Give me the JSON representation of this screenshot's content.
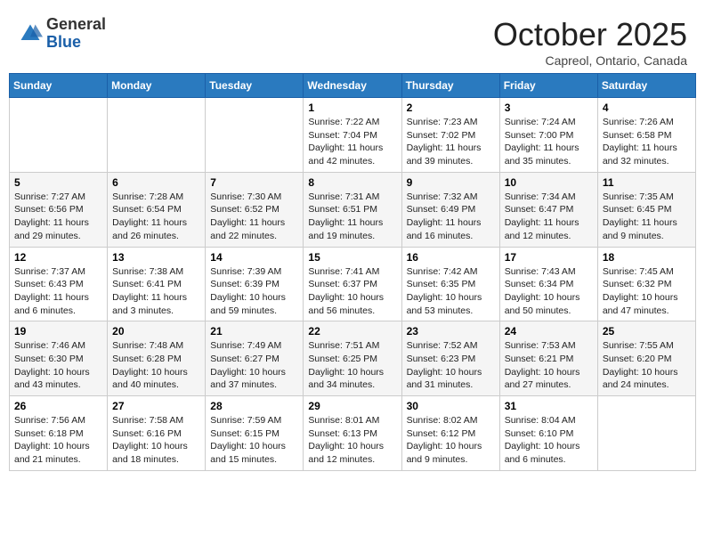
{
  "header": {
    "logo_general": "General",
    "logo_blue": "Blue",
    "month": "October 2025",
    "location": "Capreol, Ontario, Canada"
  },
  "weekdays": [
    "Sunday",
    "Monday",
    "Tuesday",
    "Wednesday",
    "Thursday",
    "Friday",
    "Saturday"
  ],
  "weeks": [
    [
      {
        "day": "",
        "info": ""
      },
      {
        "day": "",
        "info": ""
      },
      {
        "day": "",
        "info": ""
      },
      {
        "day": "1",
        "info": "Sunrise: 7:22 AM\nSunset: 7:04 PM\nDaylight: 11 hours and 42 minutes."
      },
      {
        "day": "2",
        "info": "Sunrise: 7:23 AM\nSunset: 7:02 PM\nDaylight: 11 hours and 39 minutes."
      },
      {
        "day": "3",
        "info": "Sunrise: 7:24 AM\nSunset: 7:00 PM\nDaylight: 11 hours and 35 minutes."
      },
      {
        "day": "4",
        "info": "Sunrise: 7:26 AM\nSunset: 6:58 PM\nDaylight: 11 hours and 32 minutes."
      }
    ],
    [
      {
        "day": "5",
        "info": "Sunrise: 7:27 AM\nSunset: 6:56 PM\nDaylight: 11 hours and 29 minutes."
      },
      {
        "day": "6",
        "info": "Sunrise: 7:28 AM\nSunset: 6:54 PM\nDaylight: 11 hours and 26 minutes."
      },
      {
        "day": "7",
        "info": "Sunrise: 7:30 AM\nSunset: 6:52 PM\nDaylight: 11 hours and 22 minutes."
      },
      {
        "day": "8",
        "info": "Sunrise: 7:31 AM\nSunset: 6:51 PM\nDaylight: 11 hours and 19 minutes."
      },
      {
        "day": "9",
        "info": "Sunrise: 7:32 AM\nSunset: 6:49 PM\nDaylight: 11 hours and 16 minutes."
      },
      {
        "day": "10",
        "info": "Sunrise: 7:34 AM\nSunset: 6:47 PM\nDaylight: 11 hours and 12 minutes."
      },
      {
        "day": "11",
        "info": "Sunrise: 7:35 AM\nSunset: 6:45 PM\nDaylight: 11 hours and 9 minutes."
      }
    ],
    [
      {
        "day": "12",
        "info": "Sunrise: 7:37 AM\nSunset: 6:43 PM\nDaylight: 11 hours and 6 minutes."
      },
      {
        "day": "13",
        "info": "Sunrise: 7:38 AM\nSunset: 6:41 PM\nDaylight: 11 hours and 3 minutes."
      },
      {
        "day": "14",
        "info": "Sunrise: 7:39 AM\nSunset: 6:39 PM\nDaylight: 10 hours and 59 minutes."
      },
      {
        "day": "15",
        "info": "Sunrise: 7:41 AM\nSunset: 6:37 PM\nDaylight: 10 hours and 56 minutes."
      },
      {
        "day": "16",
        "info": "Sunrise: 7:42 AM\nSunset: 6:35 PM\nDaylight: 10 hours and 53 minutes."
      },
      {
        "day": "17",
        "info": "Sunrise: 7:43 AM\nSunset: 6:34 PM\nDaylight: 10 hours and 50 minutes."
      },
      {
        "day": "18",
        "info": "Sunrise: 7:45 AM\nSunset: 6:32 PM\nDaylight: 10 hours and 47 minutes."
      }
    ],
    [
      {
        "day": "19",
        "info": "Sunrise: 7:46 AM\nSunset: 6:30 PM\nDaylight: 10 hours and 43 minutes."
      },
      {
        "day": "20",
        "info": "Sunrise: 7:48 AM\nSunset: 6:28 PM\nDaylight: 10 hours and 40 minutes."
      },
      {
        "day": "21",
        "info": "Sunrise: 7:49 AM\nSunset: 6:27 PM\nDaylight: 10 hours and 37 minutes."
      },
      {
        "day": "22",
        "info": "Sunrise: 7:51 AM\nSunset: 6:25 PM\nDaylight: 10 hours and 34 minutes."
      },
      {
        "day": "23",
        "info": "Sunrise: 7:52 AM\nSunset: 6:23 PM\nDaylight: 10 hours and 31 minutes."
      },
      {
        "day": "24",
        "info": "Sunrise: 7:53 AM\nSunset: 6:21 PM\nDaylight: 10 hours and 27 minutes."
      },
      {
        "day": "25",
        "info": "Sunrise: 7:55 AM\nSunset: 6:20 PM\nDaylight: 10 hours and 24 minutes."
      }
    ],
    [
      {
        "day": "26",
        "info": "Sunrise: 7:56 AM\nSunset: 6:18 PM\nDaylight: 10 hours and 21 minutes."
      },
      {
        "day": "27",
        "info": "Sunrise: 7:58 AM\nSunset: 6:16 PM\nDaylight: 10 hours and 18 minutes."
      },
      {
        "day": "28",
        "info": "Sunrise: 7:59 AM\nSunset: 6:15 PM\nDaylight: 10 hours and 15 minutes."
      },
      {
        "day": "29",
        "info": "Sunrise: 8:01 AM\nSunset: 6:13 PM\nDaylight: 10 hours and 12 minutes."
      },
      {
        "day": "30",
        "info": "Sunrise: 8:02 AM\nSunset: 6:12 PM\nDaylight: 10 hours and 9 minutes."
      },
      {
        "day": "31",
        "info": "Sunrise: 8:04 AM\nSunset: 6:10 PM\nDaylight: 10 hours and 6 minutes."
      },
      {
        "day": "",
        "info": ""
      }
    ]
  ]
}
